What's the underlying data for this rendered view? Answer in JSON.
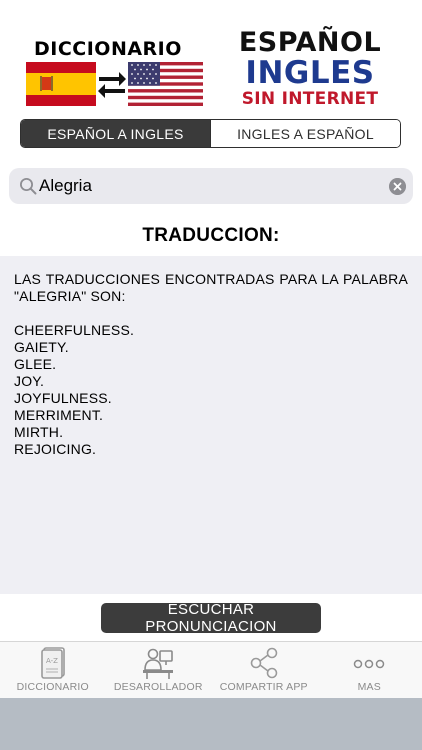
{
  "header": {
    "left_title": "DICCIONARIO",
    "right_line1": "ESPAÑOL",
    "right_line2": "INGLES",
    "right_line3": "SIN INTERNET",
    "colors": {
      "blue": "#1e3a8f",
      "red": "#c0182b"
    }
  },
  "segmented": {
    "options": [
      "ESPAÑOL A INGLES",
      "INGLES A ESPAÑOL"
    ],
    "selected_index": 0
  },
  "search": {
    "value": "Alegria",
    "placeholder": ""
  },
  "translation": {
    "title": "TRADUCCION:",
    "intro": "LAS TRADUCCIONES ENCONTRADAS PARA LA PALABRA \"ALEGRIA\" SON:",
    "results": [
      "CHEERFULNESS.",
      "GAIETY.",
      "GLEE.",
      "JOY.",
      "JOYFULNESS.",
      "MERRIMENT.",
      "MIRTH.",
      "REJOICING."
    ]
  },
  "pronunciation_button": {
    "label": "ESCUCHAR PRONUNCIACION"
  },
  "tabbar": {
    "items": [
      {
        "label": "DICCIONARIO",
        "icon": "dictionary-book-icon"
      },
      {
        "label": "DESAROLLADOR",
        "icon": "developer-icon"
      },
      {
        "label": "COMPARTIR APP",
        "icon": "share-icon"
      },
      {
        "label": "MAS",
        "icon": "more-icon"
      }
    ]
  }
}
